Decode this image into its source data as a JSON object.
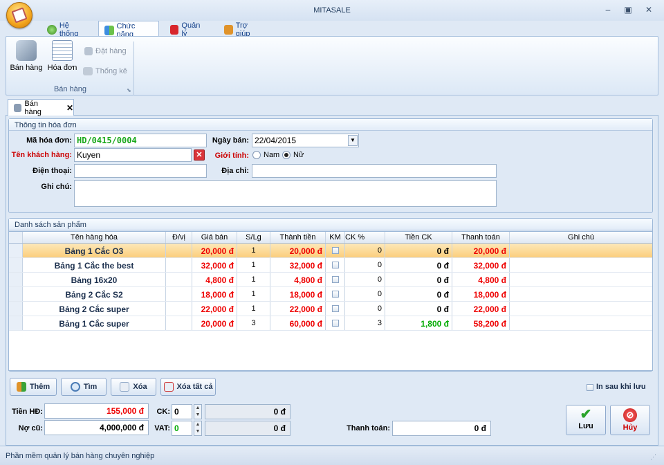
{
  "window": {
    "title": "MITASALE",
    "minimize": "–",
    "restore": "▣",
    "close": "✕"
  },
  "ribbon_tabs": [
    {
      "label": "Hệ thống"
    },
    {
      "label": "Chức năng"
    },
    {
      "label": "Quản lý"
    },
    {
      "label": "Trợ giúp"
    }
  ],
  "ribbon": {
    "ban_hang": "Bán hàng",
    "hoa_don": "Hóa đơn",
    "dat_hang": "Đặt hàng",
    "thong_ke": "Thống kê",
    "group_label": "Bán hàng"
  },
  "doc_tab": {
    "label": "Bán hàng"
  },
  "invoice": {
    "section_title": "Thông tin hóa đơn",
    "code_label": "Mã hóa đơn:",
    "code_value": "HD/0415/0004",
    "date_label": "Ngày bán:",
    "date_value": "22/04/2015",
    "customer_label": "Tên khách hàng:",
    "customer_value": "Kuyen",
    "gender_label": "Giới tính:",
    "gender_male": "Nam",
    "gender_female": "Nữ",
    "phone_label": "Điện thoại:",
    "phone_value": "",
    "address_label": "Địa chỉ:",
    "address_value": "",
    "note_label": "Ghi chú:",
    "note_value": ""
  },
  "products": {
    "section_title": "Danh sách sản phẩm",
    "columns": [
      "Tên hàng hóa",
      "Đ/vị",
      "Giá bán",
      "S/Lg",
      "Thành tiền",
      "KM",
      "CK %",
      "Tiền CK",
      "Thanh toán",
      "Ghi chú"
    ],
    "rows": [
      {
        "name": "Bảng 1 Cắc O3",
        "unit": "",
        "price": "20,000 đ",
        "qty": "1",
        "total": "20,000 đ",
        "ck": "0",
        "ck_amount": "0 đ",
        "pay": "20,000 đ",
        "note": ""
      },
      {
        "name": "Bảng 1 Cắc the best",
        "unit": "",
        "price": "32,000 đ",
        "qty": "1",
        "total": "32,000 đ",
        "ck": "0",
        "ck_amount": "0 đ",
        "pay": "32,000 đ",
        "note": ""
      },
      {
        "name": "Bảng 16x20",
        "unit": "",
        "price": "4,800 đ",
        "qty": "1",
        "total": "4,800 đ",
        "ck": "0",
        "ck_amount": "0 đ",
        "pay": "4,800 đ",
        "note": ""
      },
      {
        "name": "Bảng 2 Cắc S2",
        "unit": "",
        "price": "18,000 đ",
        "qty": "1",
        "total": "18,000 đ",
        "ck": "0",
        "ck_amount": "0 đ",
        "pay": "18,000 đ",
        "note": ""
      },
      {
        "name": "Bảng 2 Cắc super",
        "unit": "",
        "price": "22,000 đ",
        "qty": "1",
        "total": "22,000 đ",
        "ck": "0",
        "ck_amount": "0 đ",
        "pay": "22,000 đ",
        "note": ""
      },
      {
        "name": "Bảng 1 Cắc super",
        "unit": "",
        "price": "20,000 đ",
        "qty": "3",
        "total": "60,000 đ",
        "ck": "3",
        "ck_amount": "1,800 đ",
        "pay": "58,200 đ",
        "note": ""
      }
    ]
  },
  "actions": {
    "add": "Thêm",
    "find": "Tìm",
    "delete": "Xóa",
    "delete_all": "Xóa tất cả",
    "print_after_save": "In sau khi lưu"
  },
  "totals": {
    "invoice_label": "Tiền HĐ:",
    "invoice_value": "155,000 đ",
    "debt_label": "Nợ cũ:",
    "debt_value": "4,000,000 đ",
    "ck_label": "CK:",
    "ck_value": "0",
    "ck_amount": "0 đ",
    "vat_label": "VAT:",
    "vat_value": "0",
    "vat_amount": "0 đ",
    "pay_label": "Thanh toán:",
    "pay_value": "0 đ"
  },
  "buttons": {
    "save": "Lưu",
    "cancel": "Hủy"
  },
  "status": {
    "text": "Phần mềm quản lý bán hàng chuyên nghiệp"
  }
}
